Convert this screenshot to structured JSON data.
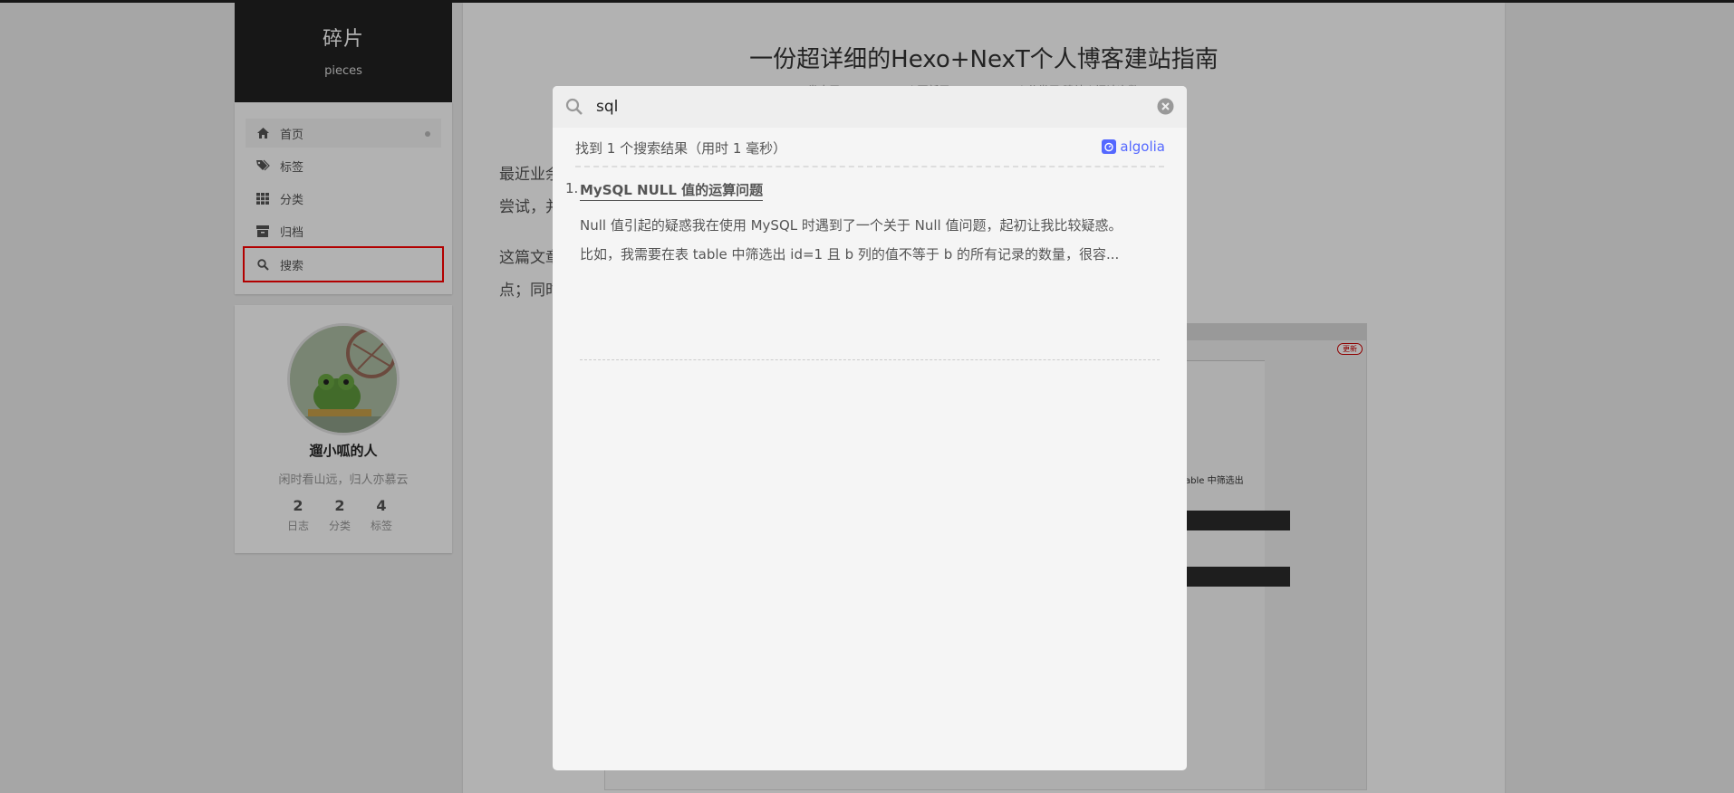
{
  "sidebar": {
    "site_title": "碎片",
    "site_subtitle": "pieces",
    "menu": [
      {
        "label": "首页",
        "icon": "home-icon"
      },
      {
        "label": "标签",
        "icon": "tags-icon"
      },
      {
        "label": "分类",
        "icon": "grid-icon"
      },
      {
        "label": "归档",
        "icon": "archive-icon"
      },
      {
        "label": "搜索",
        "icon": "search-icon"
      }
    ],
    "author": {
      "name": "遛小呱的人",
      "motto": "闲时看山远，归人亦慕云",
      "stats": [
        {
          "count": "2",
          "label": "日志"
        },
        {
          "count": "2",
          "label": "分类"
        },
        {
          "count": "4",
          "label": "标签"
        }
      ]
    }
  },
  "post": {
    "title": "一份超详细的Hexo+NexT个人博客建站指南",
    "meta": "发表于 2021-03-17 | 更新于 2021-03-23 | 分类于 建站 | 阅读次数： 1",
    "para1_line1": "最近业余时间比较多，加上一直想拥有一个属于自己的博客，我也趁此机会进行了一次博客建站的",
    "para1_line2": "尝试，并记录下了建站的过程。",
    "para2_line1": "这篇文章将会详细介绍如何使用 Hexo 和 NexT 主题，在最短的时间里搭建一个和本站类似的博客站",
    "para2_line2": "点；同时也会记录一些建站过程中遇到的问题。",
    "image": {
      "update_label": "更新",
      "snippet": "able 中筛选出"
    }
  },
  "search": {
    "query": "sql",
    "stats": "找到 1 个搜索结果（用时 1 毫秒）",
    "provider": "algolia",
    "results": [
      {
        "index": "1.",
        "title": "MySQL NULL 值的运算问题",
        "excerpt_line1": "Null 值引起的疑惑我在使用 MySQL 时遇到了一个关于 Null 值问题，起初让我比较疑惑。",
        "excerpt_line2": "比如，我需要在表 table 中筛选出 id=1 且 b 列的值不等于 b 的所有记录的数量，很容..."
      }
    ]
  },
  "colors": {
    "overlay": "rgba(0,0,0,0.30)",
    "highlight": "#ff0000",
    "algolia": "#5468ff",
    "brand_bg": "#222222"
  }
}
